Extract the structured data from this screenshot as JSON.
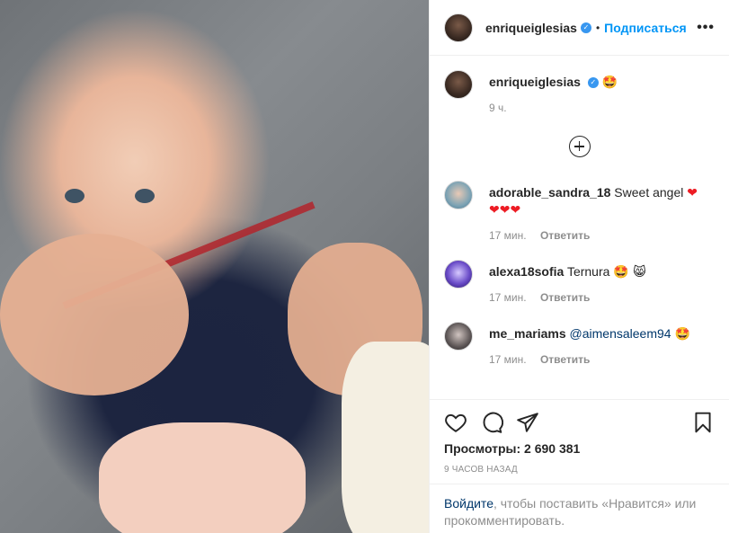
{
  "post": {
    "author": "enriqueiglesias",
    "follow_label": "Подписаться",
    "separator": "•",
    "more_label": "•••",
    "caption_emoji": "🤩",
    "caption_time": "9 ч.",
    "views_label": "Просмотры: 2 690 381",
    "posted_ago": "9 часов назад"
  },
  "comments": [
    {
      "username": "adorable_sandra_18",
      "text": "Sweet angel",
      "emoji": "❤",
      "emoji_line2": "❤❤❤",
      "time": "17 мин.",
      "reply_label": "Ответить"
    },
    {
      "username": "alexa18sofia",
      "text": "Ternura",
      "emoji": "🤩 😸",
      "time": "17 мин.",
      "reply_label": "Ответить"
    },
    {
      "username": "me_mariams",
      "mention": "@aimensaleem94",
      "emoji": "🤩",
      "time": "17 мин.",
      "reply_label": "Ответить"
    }
  ],
  "login": {
    "link": "Войдите",
    "rest": ", чтобы поставить «Нравится» или прокомментировать."
  },
  "colors": {
    "accent": "#0095f6",
    "verified": "#3897f0",
    "muted": "#8e8e8e",
    "heart": "#ed1c24"
  },
  "icons": [
    "verified-badge-icon",
    "more-options-icon",
    "load-more-comments-icon",
    "like-heart-icon",
    "comment-icon",
    "share-icon",
    "bookmark-icon"
  ]
}
